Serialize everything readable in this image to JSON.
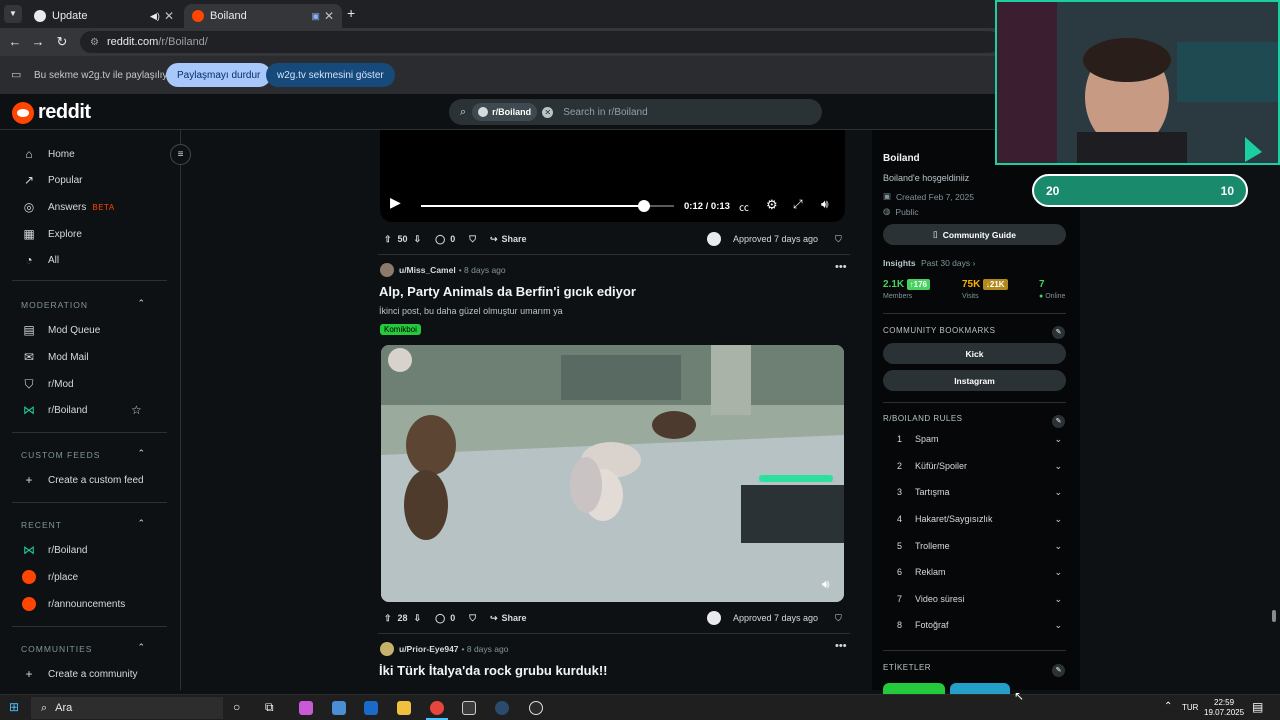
{
  "browser": {
    "tabs": [
      {
        "title": "Update"
      },
      {
        "title": "Boiland"
      }
    ],
    "url_host": "reddit.com",
    "url_path": "/r/Boiland/",
    "share_notice": "Bu sekme w2g.tv ile paylaşılıyor",
    "stop_sharing": "Paylaşmayı durdur",
    "show_tab": "w2g.tv sekmesini göster"
  },
  "header": {
    "logo_text": "reddit",
    "search_chip": "r/Boiland",
    "search_placeholder": "Search in r/Boiland"
  },
  "left_nav": {
    "main": [
      {
        "label": "Home",
        "icon": "home-icon"
      },
      {
        "label": "Popular",
        "icon": "popular-icon"
      },
      {
        "label": "Answers",
        "icon": "answers-icon",
        "badge": "BETA"
      },
      {
        "label": "Explore",
        "icon": "explore-icon"
      },
      {
        "label": "All",
        "icon": "all-icon"
      }
    ],
    "moderation_heading": "MODERATION",
    "moderation": [
      {
        "label": "Mod Queue"
      },
      {
        "label": "Mod Mail"
      },
      {
        "label": "r/Mod"
      },
      {
        "label": "r/Boiland"
      }
    ],
    "custom_feeds_heading": "CUSTOM FEEDS",
    "create_custom_feed": "Create a custom feed",
    "recent_heading": "RECENT",
    "recent": [
      {
        "label": "r/Boiland"
      },
      {
        "label": "r/place"
      },
      {
        "label": "r/announcements"
      }
    ],
    "communities_heading": "COMMUNITIES",
    "create_community": "Create a community"
  },
  "video_player": {
    "time": "0:12 / 0:13",
    "progress": 0.88
  },
  "posts": [
    {
      "votes": "50",
      "comments": "0",
      "share": "Share",
      "status": "Approved 7 days ago"
    },
    {
      "author": "u/Miss_Camel",
      "time": "• 8 days ago",
      "title": "Alp, Party Animals da Berfin'i gıcık ediyor",
      "body": "İkinci post, bu daha güzel olmuştur umarım ya",
      "flair": "Komikboi",
      "votes": "28",
      "comments": "0",
      "share": "Share",
      "status": "Approved 7 days ago"
    },
    {
      "author": "u/Prior-Eye947",
      "time": "• 8 days ago",
      "title": "İki Türk İtalya'da rock grubu kurduk!!"
    }
  ],
  "sidebar": {
    "name": "Boiland",
    "welcome": "Boiland'e hoşgeldiniiz",
    "created": "Created Feb 7, 2025",
    "visibility": "Public",
    "guide_button": "Community Guide",
    "insights_label": "Insights",
    "insights_period": "Past 30 days ›",
    "members": "2.1K",
    "members_delta": "↑176",
    "members_label": "Members",
    "visits": "75K",
    "visits_delta": "↓21K",
    "visits_label": "Visits",
    "online": "7",
    "online_label": "Online",
    "bookmarks_heading": "COMMUNITY BOOKMARKS",
    "bookmarks": [
      "Kick",
      "Instagram"
    ],
    "rules_heading": "R/BOILAND RULES",
    "rules": [
      {
        "n": "1",
        "label": "Spam"
      },
      {
        "n": "2",
        "label": "Küfür/Spoiler"
      },
      {
        "n": "3",
        "label": "Tartışma"
      },
      {
        "n": "4",
        "label": "Hakaret/Saygısızlık"
      },
      {
        "n": "5",
        "label": "Trolleme"
      },
      {
        "n": "6",
        "label": "Reklam"
      },
      {
        "n": "7",
        "label": "Video süresi"
      },
      {
        "n": "8",
        "label": "Fotoğraf"
      }
    ],
    "tags_heading": "ETİKETLER"
  },
  "overlay": {
    "left_score": "20",
    "right_score": "10"
  },
  "taskbar": {
    "search": "Ara",
    "lang": "TUR",
    "time": "22:59",
    "date": "19.07.2025"
  },
  "colors": {
    "reddit_orange": "#ff4500",
    "flair_green": "#25c93c",
    "overlay_teal": "#1ccfa3"
  }
}
